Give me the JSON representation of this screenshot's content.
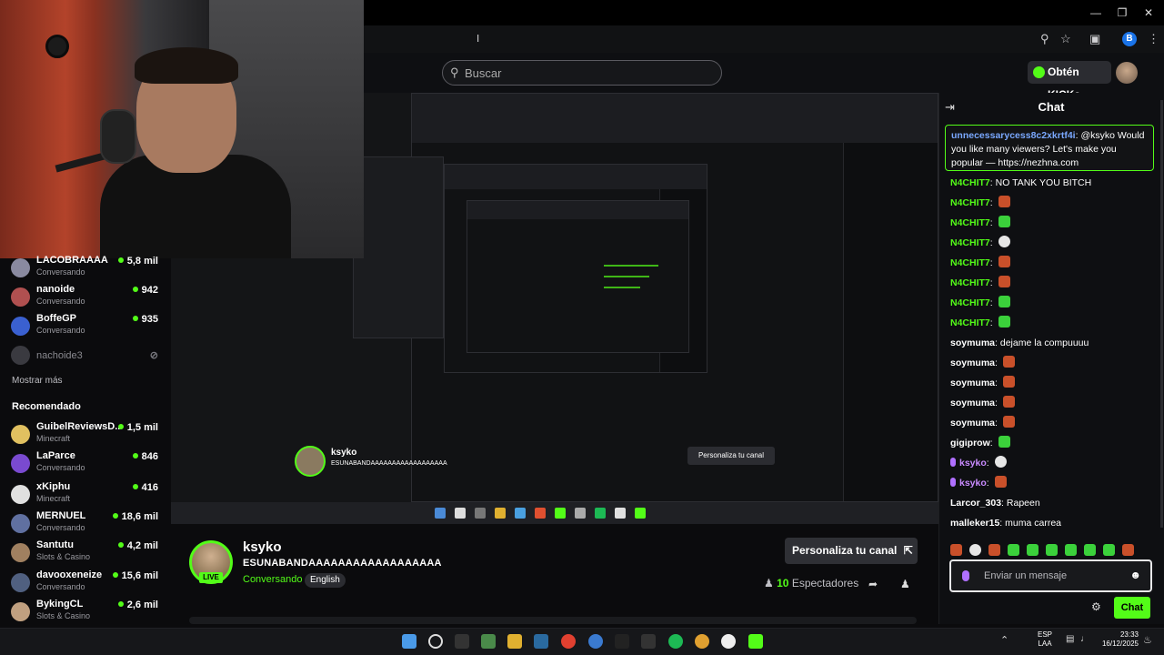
{
  "search": {
    "placeholder": "Buscar"
  },
  "header": {
    "kicks_label": "Obtén KICKs"
  },
  "sidebar": {
    "items": [
      {
        "name": "LACOBRAAAA",
        "category": "Conversando",
        "viewers": "5,8 mil",
        "avatar_color": "#8a8aa0"
      },
      {
        "name": "nanoide",
        "category": "Conversando",
        "viewers": "942",
        "avatar_color": "#b05050"
      },
      {
        "name": "BoffeGP",
        "category": "Conversando",
        "viewers": "935",
        "avatar_color": "#3a60d0"
      }
    ],
    "offline_item": {
      "name": "nachoide3"
    },
    "show_more": "Mostrar más",
    "recommended_heading": "Recomendado",
    "recommended": [
      {
        "name": "GuibelReviewsD...",
        "category": "Minecraft",
        "viewers": "1,5 mil",
        "avatar_color": "#e0c060"
      },
      {
        "name": "LaParce",
        "category": "Conversando",
        "viewers": "846",
        "avatar_color": "#7a4ad0"
      },
      {
        "name": "xKiphu",
        "category": "Minecraft",
        "viewers": "416",
        "avatar_color": "#e0e0e0"
      },
      {
        "name": "MERNUEL",
        "category": "Conversando",
        "viewers": "18,6 mil",
        "avatar_color": "#6070a0"
      },
      {
        "name": "Santutu",
        "category": "Slots & Casino",
        "viewers": "4,2 mil",
        "avatar_color": "#a08060"
      },
      {
        "name": "davooxeneize",
        "category": "Conversando",
        "viewers": "15,6 mil",
        "avatar_color": "#506080"
      },
      {
        "name": "BykingCL",
        "category": "Slots & Casino",
        "viewers": "2,6 mil",
        "avatar_color": "#c0a080"
      }
    ]
  },
  "stream": {
    "streamer": "ksyko",
    "title": "ESUNABANDAAAAAAAAAAAAAAAAAA",
    "category": "Conversando",
    "language": "English",
    "customize_label": "Personaliza tu canal",
    "viewers_count": "10",
    "viewers_label": "Espectadores",
    "live": "LIVE"
  },
  "chat": {
    "title": "Chat",
    "pinned": {
      "user": "unnecessarycess8c2xkrtf4i",
      "text": "@ksyko Would you like many viewers? Let's make you popular — https://nezhna.com"
    },
    "messages": [
      {
        "user": "N4CHIT7",
        "color": "#53fc18",
        "text": "NO TANK YOU BITCH",
        "emote": ""
      },
      {
        "user": "N4CHIT7",
        "color": "#53fc18",
        "text": "",
        "emote": "red"
      },
      {
        "user": "N4CHIT7",
        "color": "#53fc18",
        "text": "",
        "emote": "green"
      },
      {
        "user": "N4CHIT7",
        "color": "#53fc18",
        "text": "",
        "emote": "white"
      },
      {
        "user": "N4CHIT7",
        "color": "#53fc18",
        "text": "",
        "emote": "red"
      },
      {
        "user": "N4CHIT7",
        "color": "#53fc18",
        "text": "",
        "emote": "red"
      },
      {
        "user": "N4CHIT7",
        "color": "#53fc18",
        "text": "",
        "emote": "green"
      },
      {
        "user": "N4CHIT7",
        "color": "#53fc18",
        "text": "",
        "emote": "green"
      },
      {
        "user": "soymuma",
        "color": "#ffffff",
        "text": "dejame la compuuuu",
        "emote": ""
      },
      {
        "user": "soymuma",
        "color": "#ffffff",
        "text": "",
        "emote": "red"
      },
      {
        "user": "soymuma",
        "color": "#ffffff",
        "text": "",
        "emote": "red"
      },
      {
        "user": "soymuma",
        "color": "#ffffff",
        "text": "",
        "emote": "red"
      },
      {
        "user": "soymuma",
        "color": "#ffffff",
        "text": "",
        "emote": "red"
      },
      {
        "user": "gigiprow",
        "color": "#ffffff",
        "text": "",
        "emote": "green"
      },
      {
        "user": "ksyko",
        "color": "#c98bff",
        "text": "",
        "emote": "white"
      },
      {
        "user": "ksyko",
        "color": "#c98bff",
        "text": "",
        "emote": "red"
      },
      {
        "user": "Larcor_303",
        "color": "#ffffff",
        "text": "Rapeen",
        "emote": ""
      },
      {
        "user": "malleker15",
        "color": "#ffffff",
        "text": "muma carrea",
        "emote": ""
      }
    ],
    "input_placeholder": "Enviar un mensaje",
    "send_label": "Chat"
  },
  "taskbar": {
    "lang_line1": "ESP",
    "lang_line2": "LAA",
    "time": "23:33",
    "date": "16/12/2025"
  },
  "colors": {
    "accent": "#53fc18",
    "background": "#0b0b0d"
  }
}
